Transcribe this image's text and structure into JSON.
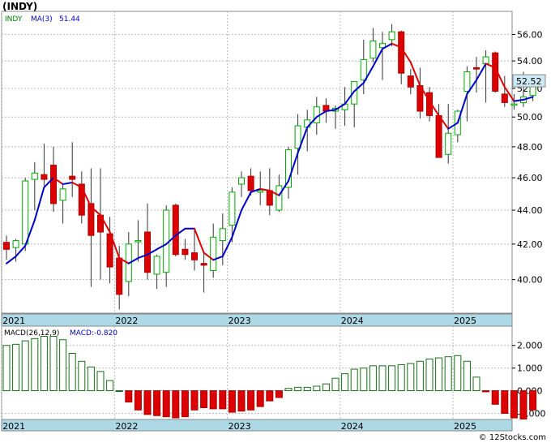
{
  "title": "(INDY)",
  "credit": "© 12Stocks.com",
  "colors": {
    "up": "#00aa00",
    "down": "#dd0000",
    "ma": "#0000cc",
    "axis_band": "#add8e6",
    "price_tag_bg": "#cde9f5",
    "macd_pos": "#1a6e1a",
    "macd_neg": "#dd0000",
    "legend_label": "#008000"
  },
  "chart_data": [
    {
      "type": "candlestick",
      "series_label": "INDY",
      "ma_label": "MA(3)",
      "ma_value": "51.44",
      "last_price": "52.52",
      "ylim": [
        38.2,
        57.8
      ],
      "log_scale": true,
      "yticks": [
        40.0,
        42.0,
        44.0,
        46.0,
        48.0,
        50.0,
        52.0,
        54.0,
        56.0
      ],
      "xlabels": [
        {
          "label": "2021",
          "i": 0
        },
        {
          "label": "2022",
          "i": 12
        },
        {
          "label": "2023",
          "i": 24
        },
        {
          "label": "2024",
          "i": 36
        },
        {
          "label": "2025",
          "i": 48
        }
      ],
      "grid": true,
      "candles": [
        [
          42.1,
          42.5,
          41.1,
          41.7
        ],
        [
          41.8,
          42.3,
          41.0,
          42.2
        ],
        [
          42.0,
          46.0,
          41.6,
          45.8
        ],
        [
          45.9,
          47.0,
          44.0,
          46.3
        ],
        [
          46.2,
          48.2,
          45.5,
          45.9
        ],
        [
          46.8,
          48.0,
          43.9,
          44.4
        ],
        [
          44.6,
          45.6,
          43.2,
          45.3
        ],
        [
          46.1,
          48.3,
          44.8,
          45.9
        ],
        [
          45.6,
          46.4,
          43.2,
          43.7
        ],
        [
          44.4,
          46.6,
          39.6,
          42.5
        ],
        [
          43.7,
          46.6,
          40.0,
          42.7
        ],
        [
          42.6,
          43.6,
          39.8,
          40.7
        ],
        [
          41.2,
          41.9,
          38.4,
          39.2
        ],
        [
          39.9,
          42.7,
          39.1,
          42.0
        ],
        [
          42.2,
          43.4,
          41.0,
          42.2
        ],
        [
          42.7,
          44.4,
          40.0,
          40.4
        ],
        [
          40.3,
          41.4,
          39.5,
          41.3
        ],
        [
          40.4,
          44.3,
          39.6,
          44.0
        ],
        [
          44.3,
          44.4,
          41.3,
          41.4
        ],
        [
          41.7,
          42.3,
          41.1,
          41.4
        ],
        [
          41.5,
          42.8,
          40.5,
          41.1
        ],
        [
          40.9,
          41.6,
          39.3,
          40.8
        ],
        [
          40.5,
          43.2,
          40.1,
          42.4
        ],
        [
          42.2,
          43.8,
          40.8,
          42.9
        ],
        [
          43.1,
          45.4,
          42.1,
          45.1
        ],
        [
          45.6,
          46.4,
          44.8,
          46.0
        ],
        [
          46.1,
          46.6,
          44.9,
          45.2
        ],
        [
          45.1,
          46.4,
          44.3,
          45.2
        ],
        [
          45.2,
          46.6,
          43.7,
          44.3
        ],
        [
          44.0,
          46.2,
          43.9,
          45.5
        ],
        [
          45.4,
          48.0,
          44.7,
          47.8
        ],
        [
          47.9,
          50.2,
          46.2,
          49.4
        ],
        [
          49.3,
          50.5,
          47.7,
          49.8
        ],
        [
          49.6,
          51.4,
          48.8,
          50.7
        ],
        [
          50.8,
          51.3,
          49.6,
          50.4
        ],
        [
          50.4,
          50.8,
          49.2,
          50.6
        ],
        [
          50.5,
          52.1,
          49.4,
          50.9
        ],
        [
          50.9,
          52.2,
          49.3,
          52.5
        ],
        [
          52.6,
          55.6,
          51.6,
          54.1
        ],
        [
          54.2,
          56.5,
          53.9,
          55.5
        ],
        [
          55.0,
          56.2,
          52.6,
          55.3
        ],
        [
          55.6,
          56.8,
          55.1,
          56.2
        ],
        [
          56.2,
          56.3,
          52.3,
          53.1
        ],
        [
          52.9,
          53.4,
          51.6,
          52.1
        ],
        [
          52.2,
          53.5,
          49.9,
          50.4
        ],
        [
          51.7,
          52.1,
          49.7,
          50.1
        ],
        [
          50.1,
          50.9,
          47.8,
          47.3
        ],
        [
          47.5,
          50.9,
          46.9,
          48.9
        ],
        [
          48.8,
          50.5,
          48.3,
          50.4
        ],
        [
          51.8,
          53.6,
          49.7,
          53.2
        ],
        [
          53.5,
          54.3,
          51.7,
          53.4
        ],
        [
          53.8,
          54.8,
          51.0,
          54.3
        ],
        [
          54.6,
          54.7,
          51.7,
          51.8
        ],
        [
          51.6,
          52.9,
          50.7,
          51.0
        ],
        [
          50.9,
          51.6,
          50.5,
          50.9
        ],
        [
          51.0,
          53.2,
          50.7,
          51.4
        ],
        [
          51.5,
          52.9,
          51.1,
          52.5
        ]
      ],
      "ma3": [
        40.9,
        41.3,
        41.9,
        43.4,
        45.4,
        46.0,
        45.6,
        45.7,
        45.4,
        44.2,
        43.7,
        42.7,
        41.2,
        40.9,
        41.2,
        41.4,
        41.7,
        42.0,
        42.5,
        42.9,
        42.9,
        41.5,
        41.1,
        41.3,
        42.4,
        44.0,
        45.1,
        45.3,
        45.2,
        44.9,
        45.8,
        47.6,
        49.3,
        50.0,
        50.4,
        50.5,
        50.9,
        51.8,
        52.4,
        53.6,
        54.9,
        55.3,
        55.0,
        53.9,
        52.2,
        51.1,
        50.1,
        49.2,
        49.6,
        51.6,
        52.6,
        53.8,
        53.5,
        52.1,
        51.1,
        51.2,
        51.4
      ]
    },
    {
      "type": "bar",
      "series_label": "MACD(26,12,9)",
      "value_label": "MACD:-0.820",
      "ylim": [
        -1.27,
        2.85
      ],
      "yticks": [
        -1.0,
        0.0,
        1.0,
        2.0
      ],
      "ytick_labels": [
        "-1.000",
        "0.000",
        "1.000",
        "2.000"
      ],
      "xlabels": [
        {
          "label": "2021",
          "i": 0
        },
        {
          "label": "2022",
          "i": 12
        },
        {
          "label": "2023",
          "i": 24
        },
        {
          "label": "2024",
          "i": 36
        },
        {
          "label": "2025",
          "i": 48
        }
      ],
      "values": [
        2.0,
        2.05,
        2.2,
        2.3,
        2.4,
        2.4,
        2.25,
        1.65,
        1.3,
        1.05,
        0.85,
        0.45,
        0.0,
        -0.5,
        -0.85,
        -1.05,
        -1.1,
        -1.15,
        -1.2,
        -1.15,
        -0.85,
        -0.75,
        -0.8,
        -0.8,
        -0.95,
        -0.9,
        -0.85,
        -0.7,
        -0.45,
        -0.3,
        0.1,
        0.15,
        0.15,
        0.2,
        0.3,
        0.55,
        0.75,
        0.95,
        1.0,
        1.1,
        1.1,
        1.1,
        1.15,
        1.2,
        1.3,
        1.4,
        1.45,
        1.5,
        1.55,
        1.3,
        0.6,
        -0.05,
        -0.6,
        -1.0,
        -1.2,
        -1.25,
        -0.85
      ]
    }
  ]
}
